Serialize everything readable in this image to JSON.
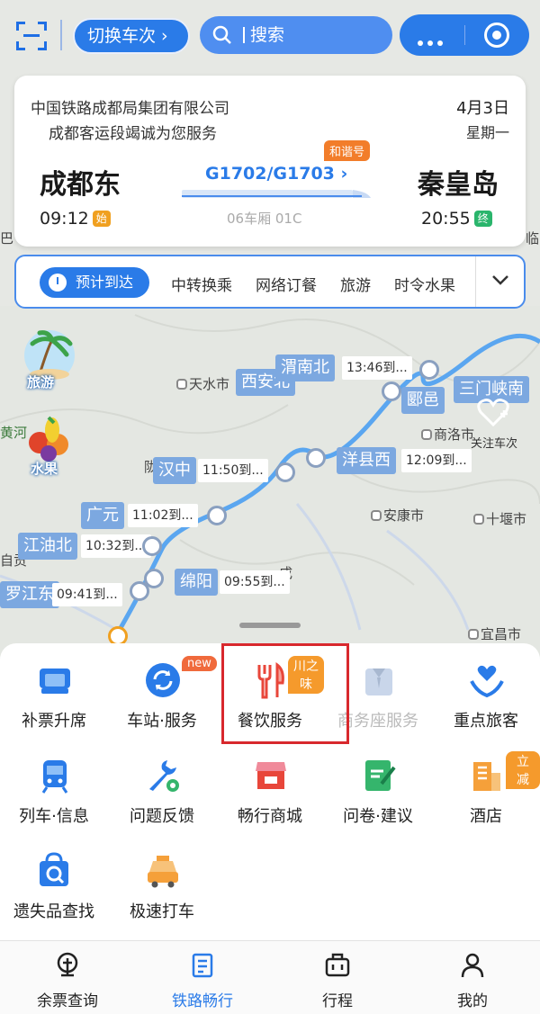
{
  "topbar": {
    "switch_label": "切换车次",
    "search_placeholder": "搜索"
  },
  "card": {
    "company": "中国铁路成都局集团有限公司",
    "service_line": "成都客运段竭诚为您服务",
    "date": "4月3日",
    "weekday": "星期一",
    "from_station": "成都东",
    "to_station": "秦皇岛",
    "depart_time": "09:12",
    "arrive_time": "20:55",
    "start_tag": "始",
    "end_tag": "终",
    "train_number": "G1702/G1703",
    "train_type": "和谐号",
    "seat": "06车厢 01C"
  },
  "tabs": {
    "active": "预计到达",
    "items": [
      "中转换乘",
      "网络订餐",
      "旅游",
      "时令水果"
    ]
  },
  "map": {
    "side_tourism": "旅游",
    "side_fruit": "水果",
    "follow_label": "关注车次",
    "cities": [
      "天水市",
      "商洛市",
      "安康市",
      "十堰市",
      "宜昌市",
      "陇",
      "黄河",
      "自贡",
      "成",
      "临",
      "巴"
    ],
    "stations": [
      {
        "name": "渭南北",
        "time": "13:46到..."
      },
      {
        "name": "西安北",
        "time": ""
      },
      {
        "name": "郾邑",
        "time": ""
      },
      {
        "name": "三门峡南",
        "time": ""
      },
      {
        "name": "洋县西",
        "time": "12:09到..."
      },
      {
        "name": "汉中",
        "time": "11:50到..."
      },
      {
        "name": "广元",
        "time": "11:02到..."
      },
      {
        "name": "江油北",
        "time": "10:32到..."
      },
      {
        "name": "绵阳",
        "time": "09:55到..."
      },
      {
        "name": "罗江东",
        "time": "09:41到..."
      }
    ]
  },
  "services": [
    {
      "label": "补票升席",
      "icon": "seat-upgrade-icon",
      "badge": ""
    },
    {
      "label": "车站·服务",
      "icon": "station-service-icon",
      "badge": "new"
    },
    {
      "label": "餐饮服务",
      "icon": "dining-icon",
      "badge": "川之味"
    },
    {
      "label": "商务座服务",
      "icon": "business-seat-icon",
      "badge": ""
    },
    {
      "label": "重点旅客",
      "icon": "priority-passenger-icon",
      "badge": ""
    },
    {
      "label": "列车·信息",
      "icon": "train-info-icon",
      "badge": ""
    },
    {
      "label": "问题反馈",
      "icon": "feedback-icon",
      "badge": ""
    },
    {
      "label": "畅行商城",
      "icon": "mall-icon",
      "badge": ""
    },
    {
      "label": "问卷·建议",
      "icon": "survey-icon",
      "badge": ""
    },
    {
      "label": "酒店",
      "icon": "hotel-icon",
      "badge": "立减"
    },
    {
      "label": "遗失品查找",
      "icon": "lost-found-icon",
      "badge": ""
    },
    {
      "label": "极速打车",
      "icon": "taxi-icon",
      "badge": ""
    }
  ],
  "nav": [
    {
      "label": "余票查询",
      "icon": "train-ticket-icon"
    },
    {
      "label": "铁路畅行",
      "icon": "railway-icon"
    },
    {
      "label": "行程",
      "icon": "trip-bag-icon"
    },
    {
      "label": "我的",
      "icon": "user-icon"
    }
  ],
  "colors": {
    "primary": "#2a7be8",
    "highlight_border": "#d8282d",
    "badge_red": "#f06a3c",
    "badge_orange": "#f59a2c"
  }
}
